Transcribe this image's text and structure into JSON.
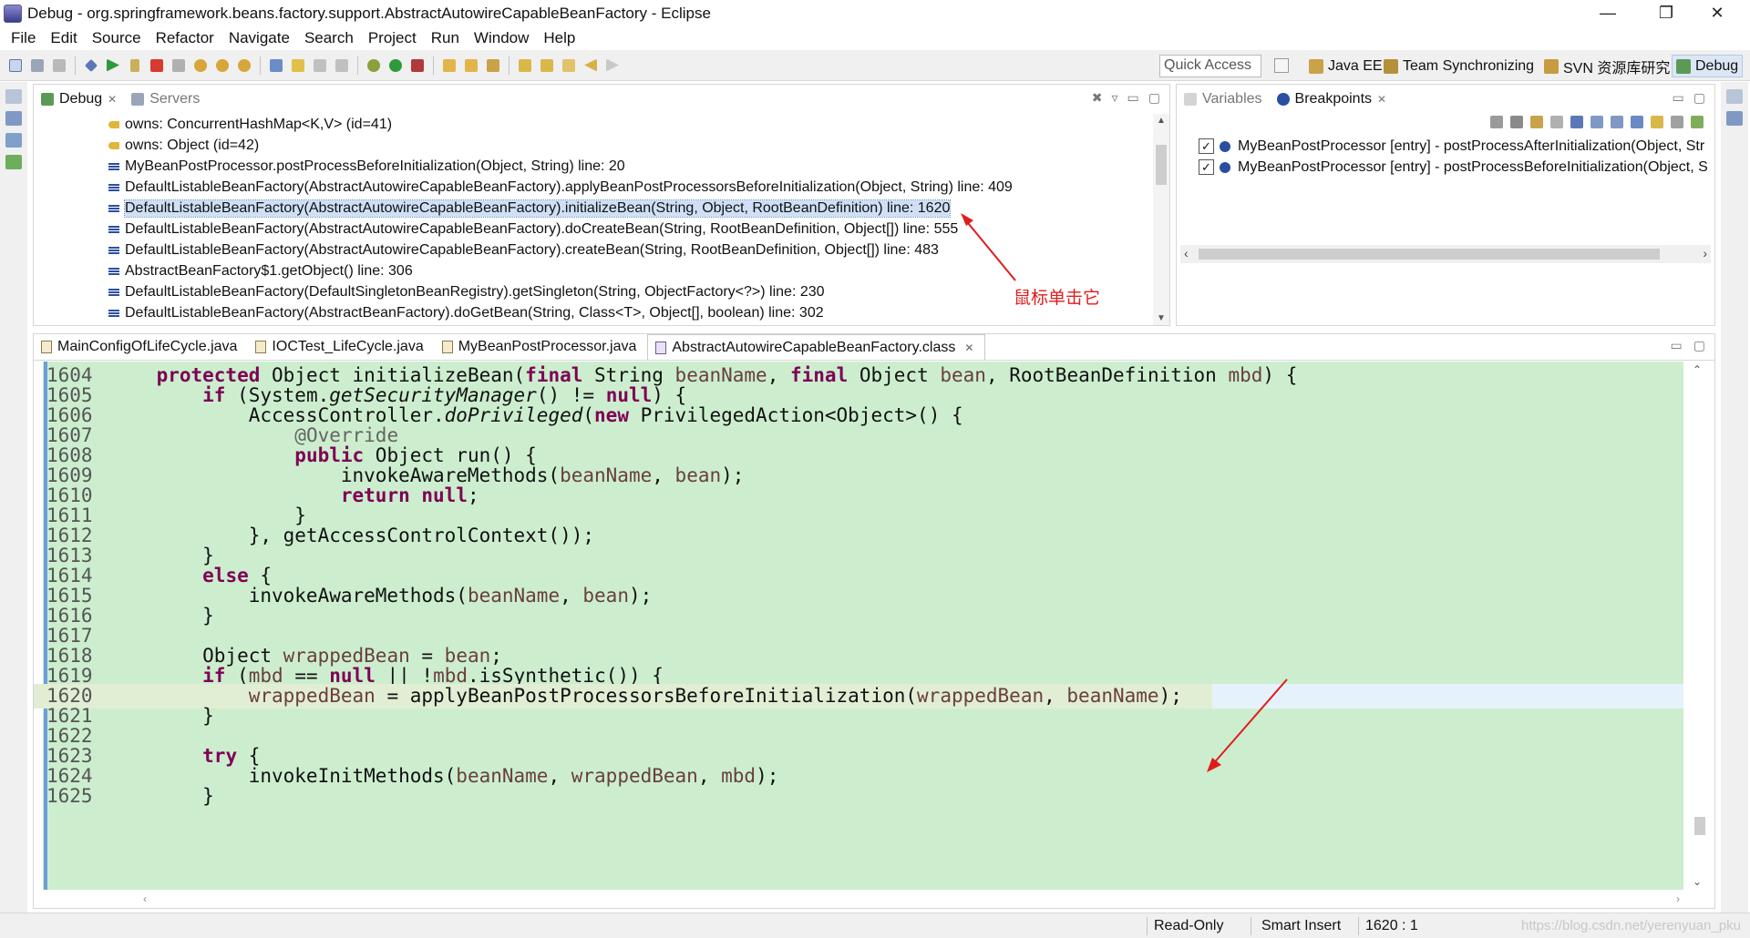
{
  "window": {
    "title": "Debug - org.springframework.beans.factory.support.AbstractAutowireCapableBeanFactory - Eclipse",
    "minimize": "—",
    "maximize": "❐",
    "close": "✕"
  },
  "menu": [
    "File",
    "Edit",
    "Source",
    "Refactor",
    "Navigate",
    "Search",
    "Project",
    "Run",
    "Window",
    "Help"
  ],
  "toolbar": {
    "quick_access_placeholder": "Quick Access",
    "perspectives": [
      {
        "label": "Java EE",
        "icon": "java-ee-icon",
        "active": false
      },
      {
        "label": "Team Synchronizing",
        "icon": "team-sync-icon",
        "active": false
      },
      {
        "label": "SVN 资源库研究",
        "icon": "svn-icon",
        "active": false
      },
      {
        "label": "Debug",
        "icon": "debug-perspective-icon",
        "active": true
      }
    ]
  },
  "debug_view": {
    "tabs": [
      {
        "label": "Debug",
        "icon": "debug-icon",
        "active": true
      },
      {
        "label": "Servers",
        "icon": "servers-icon",
        "active": false
      }
    ],
    "frames": [
      {
        "text": "owns: ConcurrentHashMap<K,V>  (id=41)",
        "icon": "key-icon",
        "selected": false
      },
      {
        "text": "owns: Object  (id=42)",
        "icon": "key-icon",
        "selected": false
      },
      {
        "text": "MyBeanPostProcessor.postProcessBeforeInitialization(Object, String) line: 20",
        "icon": "stack-frame-icon",
        "selected": false
      },
      {
        "text": "DefaultListableBeanFactory(AbstractAutowireCapableBeanFactory).applyBeanPostProcessorsBeforeInitialization(Object, String) line: 409",
        "icon": "stack-frame-icon",
        "selected": false
      },
      {
        "text": "DefaultListableBeanFactory(AbstractAutowireCapableBeanFactory).initializeBean(String, Object, RootBeanDefinition) line: 1620",
        "icon": "stack-frame-icon",
        "selected": true
      },
      {
        "text": "DefaultListableBeanFactory(AbstractAutowireCapableBeanFactory).doCreateBean(String, RootBeanDefinition, Object[]) line: 555",
        "icon": "stack-frame-icon",
        "selected": false
      },
      {
        "text": "DefaultListableBeanFactory(AbstractAutowireCapableBeanFactory).createBean(String, RootBeanDefinition, Object[]) line: 483",
        "icon": "stack-frame-icon",
        "selected": false
      },
      {
        "text": "AbstractBeanFactory$1.getObject() line: 306",
        "icon": "stack-frame-icon",
        "selected": false
      },
      {
        "text": "DefaultListableBeanFactory(DefaultSingletonBeanRegistry).getSingleton(String, ObjectFactory<?>) line: 230",
        "icon": "stack-frame-icon",
        "selected": false
      },
      {
        "text": "DefaultListableBeanFactory(AbstractBeanFactory).doGetBean(String, Class<T>, Object[], boolean) line: 302",
        "icon": "stack-frame-icon",
        "selected": false
      }
    ],
    "annotation": "鼠标单击它"
  },
  "breakpoints_view": {
    "tabs": [
      {
        "label": "Variables",
        "icon": "variables-icon",
        "active": false
      },
      {
        "label": "Breakpoints",
        "icon": "breakpoints-icon",
        "active": true
      }
    ],
    "items": [
      {
        "text": "MyBeanPostProcessor [entry] - postProcessAfterInitialization(Object, Str",
        "checked": true
      },
      {
        "text": "MyBeanPostProcessor [entry] - postProcessBeforeInitialization(Object, S",
        "checked": true
      }
    ]
  },
  "editor": {
    "tabs": [
      {
        "label": "MainConfigOfLifeCycle.java",
        "active": false
      },
      {
        "label": "IOCTest_LifeCycle.java",
        "active": false
      },
      {
        "label": "MyBeanPostProcessor.java",
        "active": false
      },
      {
        "label": "AbstractAutowireCapableBeanFactory.class",
        "active": true
      }
    ],
    "current_line": "1620",
    "lines": [
      {
        "num": "1604",
        "text": "    protected Object initializeBean(final String beanName, final Object bean, RootBeanDefinition mbd) {"
      },
      {
        "num": "1605",
        "text": "        if (System.getSecurityManager() != null) {"
      },
      {
        "num": "1606",
        "text": "            AccessController.doPrivileged(new PrivilegedAction<Object>() {"
      },
      {
        "num": "1607",
        "text": "                @Override"
      },
      {
        "num": "1608",
        "text": "                public Object run() {"
      },
      {
        "num": "1609",
        "text": "                    invokeAwareMethods(beanName, bean);"
      },
      {
        "num": "1610",
        "text": "                    return null;"
      },
      {
        "num": "1611",
        "text": "                }"
      },
      {
        "num": "1612",
        "text": "            }, getAccessControlContext());"
      },
      {
        "num": "1613",
        "text": "        }"
      },
      {
        "num": "1614",
        "text": "        else {"
      },
      {
        "num": "1615",
        "text": "            invokeAwareMethods(beanName, bean);"
      },
      {
        "num": "1616",
        "text": "        }"
      },
      {
        "num": "1617",
        "text": ""
      },
      {
        "num": "1618",
        "text": "        Object wrappedBean = bean;"
      },
      {
        "num": "1619",
        "text": "        if (mbd == null || !mbd.isSynthetic()) {"
      },
      {
        "num": "1620",
        "text": "            wrappedBean = applyBeanPostProcessorsBeforeInitialization(wrappedBean, beanName);"
      },
      {
        "num": "1621",
        "text": "        }"
      },
      {
        "num": "1622",
        "text": ""
      },
      {
        "num": "1623",
        "text": "        try {"
      },
      {
        "num": "1624",
        "text": "            invokeInitMethods(beanName, wrappedBean, mbd);"
      },
      {
        "num": "1625",
        "text": "        }"
      }
    ]
  },
  "status": {
    "read_only": "Read-Only",
    "insert_mode": "Smart Insert",
    "position": "1620 : 1",
    "watermark": "https://blog.csdn.net/yerenyuan_pku"
  },
  "colors": {
    "keyword": "#7f0055",
    "variable": "#6a3e3e",
    "debug_highlight": "#cceecf",
    "current_line": "#e6f2fb",
    "selection": "#cfe0f6",
    "annotation_red": "#e01d1d"
  }
}
